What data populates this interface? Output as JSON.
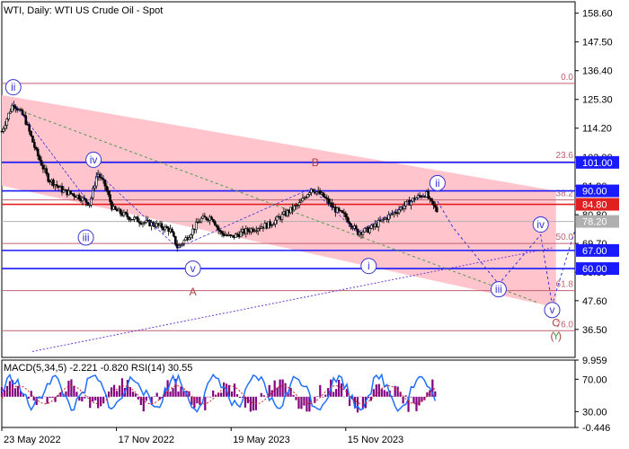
{
  "chart_title": "WTI, Daily:  WTI US Crude Oil - Spot",
  "indicator_label": "MACD(5,34,5) -2.221 -0.820 RSI(14) 30.55",
  "colors": {
    "background": "#ffffff",
    "channel_fill": "#ffc4cc",
    "candle": "#000000",
    "fib_line": "#c06070",
    "level_line": "#1a1aff",
    "label_blue": "#1a1aff",
    "price_red": "#e02020",
    "price_grey": "#b0b0b0",
    "wave_blue": "#3535d0",
    "wave_brown": "#b04040",
    "forecast_dash": "#3535d0",
    "trend_green": "#4a9a4a",
    "macd_hist": "#800080",
    "macd_signal": "#d02020",
    "rsi_line": "#2070ff"
  },
  "chart_data": {
    "type": "line",
    "subtype": "candlestick_daily",
    "title": "WTI, Daily:  WTI US Crude Oil - Spot",
    "ylim": [
      25.7,
      163.0
    ],
    "y_ticks": [
      158.6,
      147.5,
      136.4,
      125.3,
      114.2,
      103.0,
      91.9,
      80.8,
      69.7,
      58.6,
      47.6,
      36.5
    ],
    "x_ticks": [
      "23 May 2022",
      "17 Nov 2022",
      "19 May 2023",
      "15 Nov 2023"
    ],
    "price_path": [
      [
        0,
        113
      ],
      [
        3,
        124
      ],
      [
        6,
        118
      ],
      [
        9,
        105
      ],
      [
        12,
        95
      ],
      [
        16,
        90
      ],
      [
        20,
        88
      ],
      [
        23,
        85
      ],
      [
        25,
        97
      ],
      [
        27,
        92
      ],
      [
        29,
        83
      ],
      [
        33,
        80
      ],
      [
        37,
        78
      ],
      [
        40,
        77
      ],
      [
        44,
        75
      ],
      [
        46,
        68
      ],
      [
        49,
        73
      ],
      [
        52,
        79
      ],
      [
        55,
        80
      ],
      [
        57,
        74
      ],
      [
        60,
        72
      ],
      [
        63,
        74
      ],
      [
        67,
        76
      ],
      [
        70,
        77
      ],
      [
        74,
        81
      ],
      [
        78,
        85
      ],
      [
        81,
        91
      ],
      [
        84,
        88
      ],
      [
        87,
        83
      ],
      [
        90,
        80
      ],
      [
        93,
        74
      ],
      [
        96,
        75
      ],
      [
        99,
        78
      ],
      [
        102,
        81
      ],
      [
        105,
        84
      ],
      [
        108,
        87
      ],
      [
        111,
        89
      ],
      [
        112,
        86
      ],
      [
        114,
        82
      ]
    ],
    "fib_levels": [
      {
        "label": "0.0",
        "value": 131.5
      },
      {
        "label": "23.6",
        "value": 101.2
      },
      {
        "label": "38.2",
        "value": 86.5
      },
      {
        "label": "50.0",
        "value": 69.7
      },
      {
        "label": "61.8",
        "value": 51.5
      },
      {
        "label": "76.0",
        "value": 36.0
      }
    ],
    "price_levels": [
      {
        "label": "101.00",
        "value": 101.0,
        "style": "blue"
      },
      {
        "label": "90.00",
        "value": 90.0,
        "style": "blue"
      },
      {
        "label": "84.80",
        "value": 84.8,
        "style": "red"
      },
      {
        "label": "78.20",
        "value": 78.2,
        "style": "grey"
      },
      {
        "label": "67.00",
        "value": 67.0,
        "style": "blue"
      },
      {
        "label": "60.00",
        "value": 60.0,
        "style": "blue"
      }
    ],
    "channel": {
      "upper": [
        [
          0,
          127
        ],
        [
          145,
          90
        ]
      ],
      "lower": [
        [
          0,
          92
        ],
        [
          145,
          45
        ]
      ]
    },
    "dotted_trend": [
      [
        8,
        28
      ],
      [
        144,
        68
      ]
    ],
    "green_dashed": [
      [
        3,
        122
      ],
      [
        140,
        47
      ]
    ],
    "wave_labels": [
      {
        "text": "ii",
        "t": 3,
        "y": 130,
        "style": "circle"
      },
      {
        "text": "iv",
        "t": 24,
        "y": 102,
        "style": "circle"
      },
      {
        "text": "iii",
        "t": 22,
        "y": 72,
        "style": "circle"
      },
      {
        "text": "v",
        "t": 50,
        "y": 60,
        "style": "circle"
      },
      {
        "text": "A",
        "t": 50,
        "y": 51,
        "style": "plain"
      },
      {
        "text": "B",
        "t": 82,
        "y": 101,
        "style": "plain"
      },
      {
        "text": "i",
        "t": 96,
        "y": 61,
        "style": "circle"
      },
      {
        "text": "ii",
        "t": 114,
        "y": 93,
        "style": "circle"
      },
      {
        "text": "iv",
        "t": 141,
        "y": 77,
        "style": "circle"
      },
      {
        "text": "iii",
        "t": 130,
        "y": 52,
        "style": "circle"
      },
      {
        "text": "v",
        "t": 144,
        "y": 44,
        "style": "circle"
      },
      {
        "text": "C",
        "t": 145,
        "y": 39,
        "style": "plain"
      },
      {
        "text": "(",
        "t": 144,
        "y": 34,
        "style": "plain"
      },
      {
        "text": "Y",
        "t": 145,
        "y": 34,
        "style": "plain"
      },
      {
        "text": ")",
        "t": 146,
        "y": 34,
        "style": "plain"
      }
    ],
    "forecast_path": [
      [
        114,
        86
      ],
      [
        118,
        76
      ],
      [
        130,
        54
      ],
      [
        141,
        73
      ],
      [
        144,
        46
      ],
      [
        150,
        75
      ]
    ],
    "forecast_dashed_from": [
      [
        114,
        86
      ],
      [
        127,
        52
      ]
    ],
    "macd_axis": {
      "ylim": [
        -0.446,
        9.959
      ],
      "ticks": [
        "9.959",
        "70.00",
        "30.00",
        "-0.446"
      ]
    }
  }
}
